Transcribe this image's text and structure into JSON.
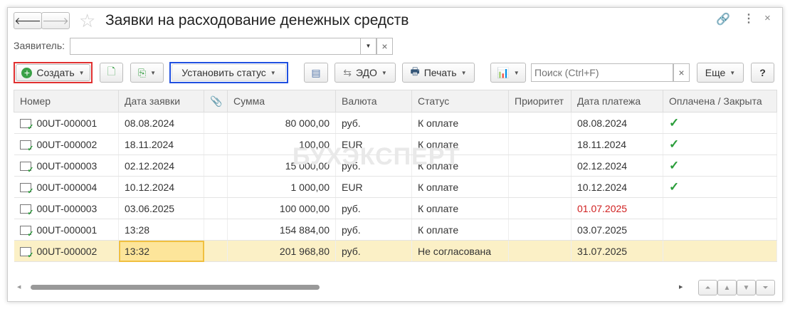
{
  "title": "Заявки на расходование денежных средств",
  "filter": {
    "label": "Заявитель:",
    "value": ""
  },
  "toolbar": {
    "create": "Создать",
    "set_status": "Установить статус",
    "edo": "ЭДО",
    "print": "Печать",
    "search_placeholder": "Поиск (Ctrl+F)",
    "more": "Еще",
    "help": "?"
  },
  "watermark": "БУХЭКСПЕРТ",
  "columns": [
    "Номер",
    "Дата заявки",
    "",
    "Сумма",
    "Валюта",
    "Статус",
    "Приоритет",
    "Дата платежа",
    "Оплачена / Закрыта"
  ],
  "rows": [
    {
      "num": "00UT-000001",
      "date": "08.08.2024",
      "sum": "80 000,00",
      "cur": "руб.",
      "status": "К оплате",
      "prio": "",
      "pay": "08.08.2024",
      "paid": "✓"
    },
    {
      "num": "00UT-000002",
      "date": "18.11.2024",
      "sum": "100,00",
      "cur": "EUR",
      "status": "К оплате",
      "prio": "",
      "pay": "18.11.2024",
      "paid": "✓"
    },
    {
      "num": "00UT-000003",
      "date": "02.12.2024",
      "sum": "15 000,00",
      "cur": "руб.",
      "status": "К оплате",
      "prio": "",
      "pay": "02.12.2024",
      "paid": "✓"
    },
    {
      "num": "00UT-000004",
      "date": "10.12.2024",
      "sum": "1 000,00",
      "cur": "EUR",
      "status": "К оплате",
      "prio": "",
      "pay": "10.12.2024",
      "paid": "✓"
    },
    {
      "num": "00UT-000003",
      "date": "03.06.2025",
      "sum": "100 000,00",
      "cur": "руб.",
      "status": "К оплате",
      "prio": "",
      "pay": "01.07.2025",
      "paid": ""
    },
    {
      "num": "00UT-000001",
      "date": "13:28",
      "sum": "154 884,00",
      "cur": "руб.",
      "status": "К оплате",
      "prio": "",
      "pay": "03.07.2025",
      "paid": ""
    },
    {
      "num": "00UT-000002",
      "date": "13:32",
      "sum": "201 968,80",
      "cur": "руб.",
      "status": "Не согласована",
      "prio": "",
      "pay": "31.07.2025",
      "paid": ""
    }
  ]
}
